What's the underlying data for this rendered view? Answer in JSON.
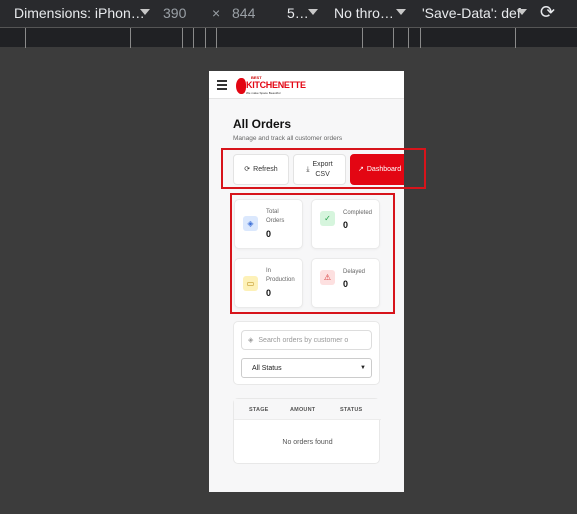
{
  "devtools": {
    "device": "Dimensions: iPhon…",
    "width": "390",
    "times": "×",
    "height": "844",
    "zoom": "5…",
    "throttle": "No thro…",
    "save_data": "'Save-Data': def"
  },
  "header": {
    "logo_best": "BEST",
    "logo_main": "KITCHENETTE",
    "logo_sub": "We make Space Beautiful"
  },
  "page": {
    "title": "All Orders",
    "subtitle": "Manage and track all customer orders"
  },
  "actions": {
    "refresh": "Refresh",
    "export_line1": "Export",
    "export_line2": "CSV",
    "dashboard": "Dashboard"
  },
  "stats": {
    "total_label_1": "Total",
    "total_label_2": "Orders",
    "total_value": "0",
    "completed_label": "Completed",
    "completed_value": "0",
    "production_label_1": "In",
    "production_label_2": "Production",
    "production_value": "0",
    "delayed_label": "Delayed",
    "delayed_value": "0"
  },
  "filters": {
    "search_placeholder": "Search orders by customer o",
    "status_selected": "All Status"
  },
  "table": {
    "columns": [
      "STAGE",
      "AMOUNT",
      "STATUS"
    ],
    "empty_text": "No orders found"
  },
  "colors": {
    "brand": "#e30613",
    "highlight": "#d7141b"
  }
}
